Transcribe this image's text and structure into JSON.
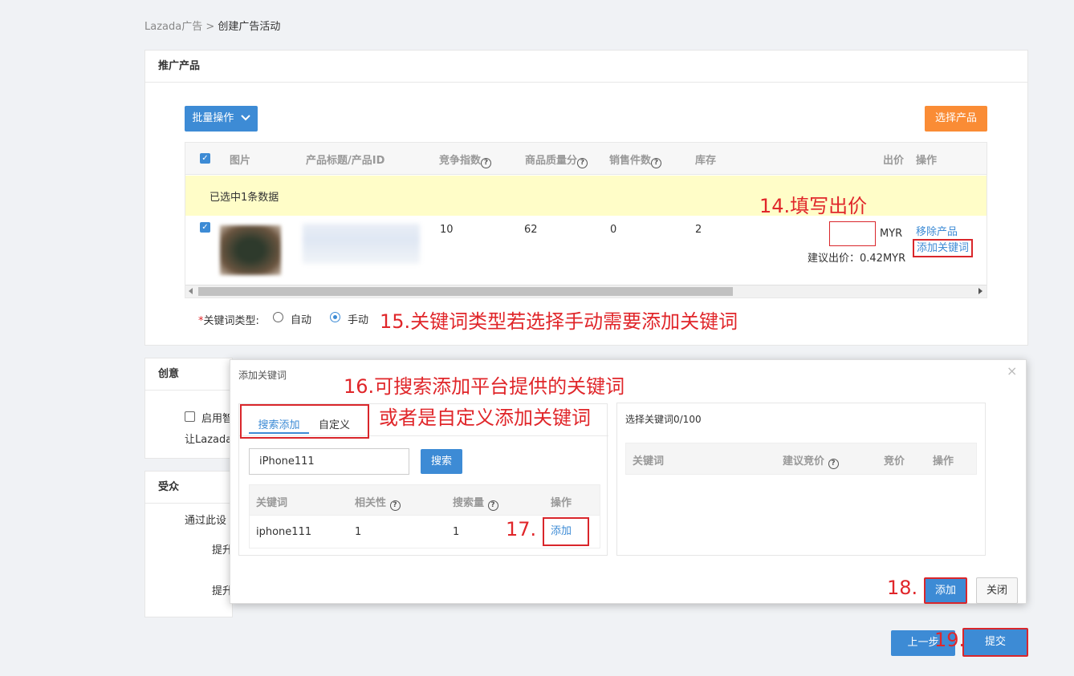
{
  "breadcrumb": {
    "parent": "Lazada广告",
    "sep": ">",
    "current": "创建广告活动"
  },
  "product_card": {
    "title": "推广产品",
    "batch_button": "批量操作",
    "select_product_button": "选择产品",
    "columns": [
      "图片",
      "产品标题/产品ID",
      "竞争指数",
      "商品质量分",
      "销售件数",
      "库存",
      "出价",
      "操作"
    ],
    "selected_notice": "已选中1条数据",
    "row": {
      "competition": "10",
      "quality": "62",
      "sales": "0",
      "stock": "2",
      "bid_value": "",
      "bid_unit": "MYR",
      "suggested_bid": "建议出价：0.42MYR",
      "remove_link": "移除产品",
      "add_keyword_link": "添加关键词"
    },
    "keyword_type_label": "关键词类型:",
    "keyword_type_required": "*",
    "keyword_type_auto": "自动",
    "keyword_type_manual": "手动"
  },
  "creative_card": {
    "title": "创意",
    "checkbox_label": "启用智",
    "text": "让Lazada"
  },
  "audience_card": {
    "title": "受众",
    "text": "通过此设",
    "row1": "提升",
    "row2": "提升"
  },
  "modal": {
    "title": "添加关键词",
    "close": "×",
    "tabs": [
      "搜索添加",
      "自定义"
    ],
    "search_value": "iPhone111",
    "search_button": "搜索",
    "left_columns": [
      "关键词",
      "相关性",
      "搜索量",
      "操作"
    ],
    "left_row": {
      "keyword": "iphone111",
      "relevance": "1",
      "volume": "1",
      "action": "添加"
    },
    "selected_title": "选择关键词0/100",
    "right_columns": [
      "关键词",
      "建议竞价",
      "竞价",
      "操作"
    ],
    "add_button": "添加",
    "close_button": "关闭"
  },
  "footer": {
    "prev_button": "上一步",
    "submit_button": "提交"
  },
  "annotations": {
    "a14": "14.填写出价",
    "a15": "15.关键词类型若选择手动需要添加关键词",
    "a16_line1": "16.可搜索添加平台提供的关键词",
    "a16_line2": "或者是自定义添加关键词",
    "a17": "17.",
    "a18": "18.",
    "a19": "19."
  },
  "colors": {
    "primary": "#3d8bd5",
    "orange": "#fa8c35",
    "annotation": "#e0262a",
    "highlight_row": "#fffdc8"
  }
}
